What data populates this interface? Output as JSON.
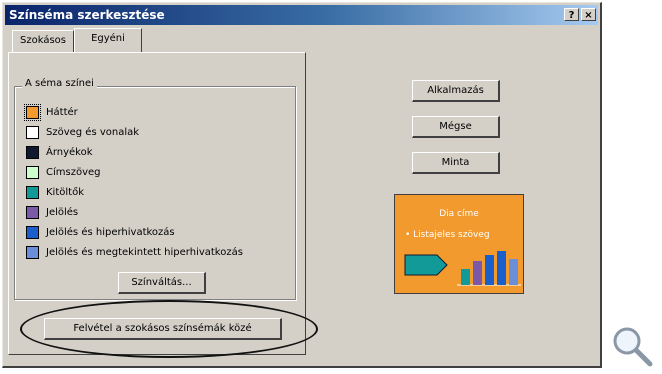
{
  "window": {
    "title": "Színséma szerkesztése",
    "help_label": "?",
    "close_label": "×"
  },
  "tabs": [
    {
      "label": "Szokásos",
      "active": false
    },
    {
      "label": "Egyéni",
      "active": true
    }
  ],
  "scheme": {
    "group_title": "A séma színei",
    "items": [
      {
        "label": "Háttér",
        "color": "#f29a2e",
        "selected": true
      },
      {
        "label": "Szöveg és vonalak",
        "color": "#ffffff",
        "selected": false
      },
      {
        "label": "Árnyékok",
        "color": "#101830",
        "selected": false
      },
      {
        "label": "Címszöveg",
        "color": "#ccffcc",
        "selected": false
      },
      {
        "label": "Kitöltők",
        "color": "#129a98",
        "selected": false
      },
      {
        "label": "Jelölés",
        "color": "#7b59a8",
        "selected": false
      },
      {
        "label": "Jelölés és hiperhivatkozás",
        "color": "#1a5fcc",
        "selected": false
      },
      {
        "label": "Jelölés és megtekintett hiperhivatkozás",
        "color": "#6a8fd8",
        "selected": false
      }
    ],
    "change_color_label": "Színváltás..."
  },
  "add_scheme_label": "Felvétel a szokásos színsémák közé",
  "buttons": {
    "apply": "Alkalmazás",
    "cancel": "Mégse",
    "preview": "Minta"
  },
  "preview": {
    "title": "Dia címe",
    "bullet": "• Listajeles szöveg"
  },
  "zoom_icon": "magnifier-icon"
}
